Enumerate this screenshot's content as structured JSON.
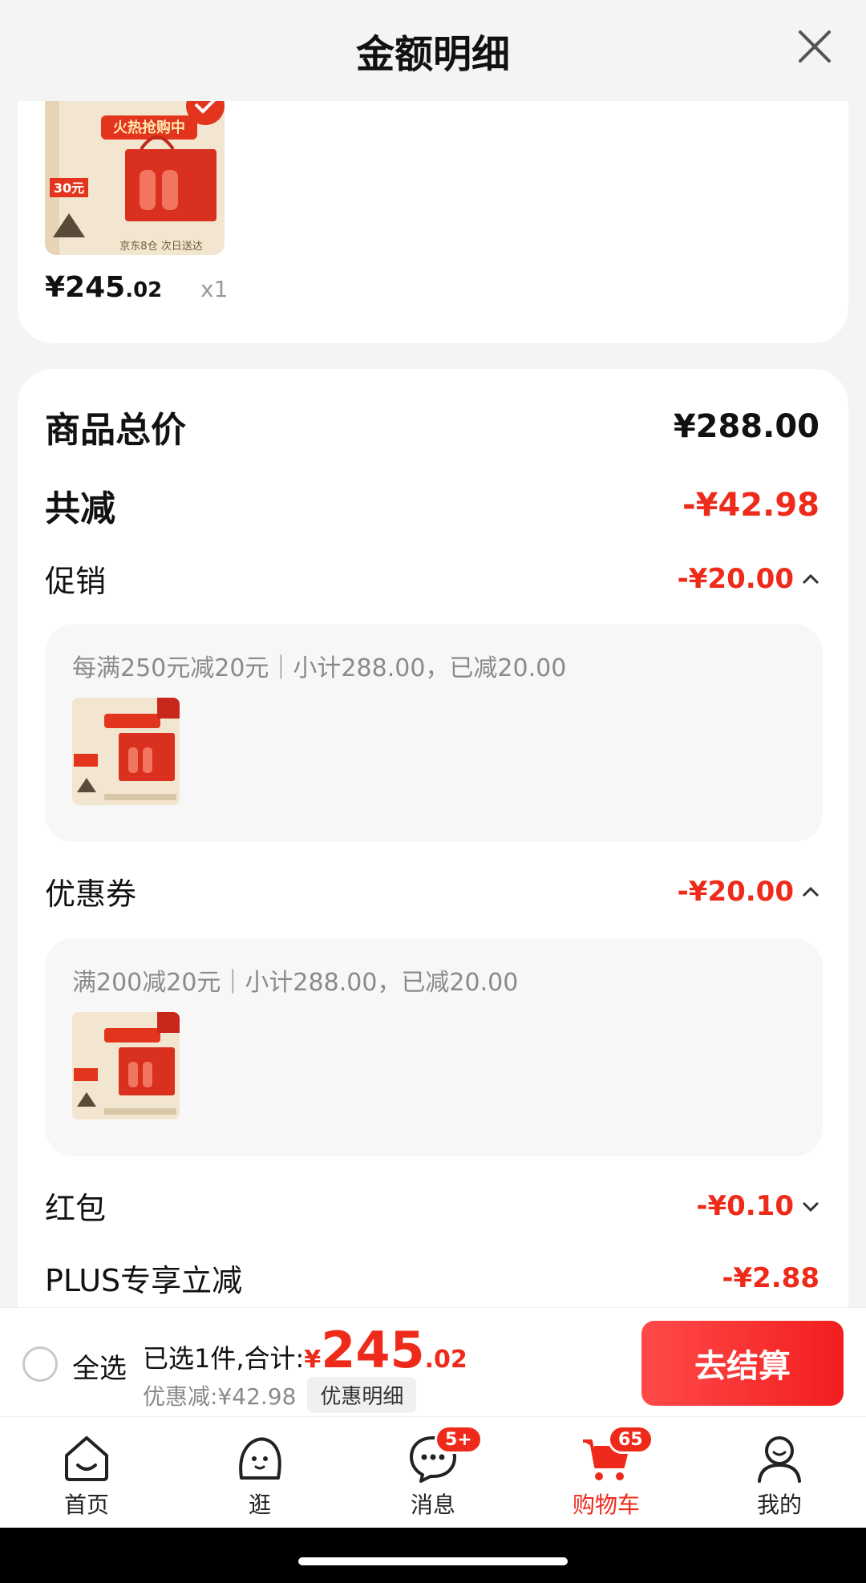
{
  "header": {
    "title": "金额明细"
  },
  "item": {
    "price_int": "¥245",
    "price_dec": ".02",
    "quantity": "x1",
    "image_text": {
      "badge": "火热抢购中",
      "promo": "30元",
      "footer": "京东8仓 次日送达"
    }
  },
  "summary": {
    "total_label": "商品总价",
    "total_value": "¥288.00",
    "discount_label": "共减",
    "discount_value": "-¥42.98"
  },
  "promotion": {
    "label": "促销",
    "value": "-¥20.00",
    "rule": "每满250元减20元｜小计288.00，已减20.00"
  },
  "coupon": {
    "label": "优惠券",
    "value": "-¥20.00",
    "rule": "满200减20元｜小计288.00，已减20.00"
  },
  "redpacket": {
    "label": "红包",
    "value": "-¥0.10"
  },
  "plus": {
    "label": "PLUS专享立减",
    "value": "-¥2.88"
  },
  "checkout": {
    "select_all": "全选",
    "summary_text": "已选1件,合计:",
    "currency": "¥",
    "total_int": "245",
    "total_dec": ".02",
    "discount_text": "优惠减:¥42.98",
    "detail_link": "优惠明细",
    "button": "去结算"
  },
  "tabs": [
    {
      "label": "首页",
      "icon": "home-icon"
    },
    {
      "label": "逛",
      "icon": "explore-icon"
    },
    {
      "label": "消息",
      "icon": "message-icon",
      "badge": "5+"
    },
    {
      "label": "购物车",
      "icon": "cart-icon",
      "badge": "65",
      "active": true
    },
    {
      "label": "我的",
      "icon": "profile-icon"
    }
  ],
  "colors": {
    "accent": "#ee2a1a",
    "muted": "#8a8a8a",
    "panel": "#f7f7f7"
  }
}
